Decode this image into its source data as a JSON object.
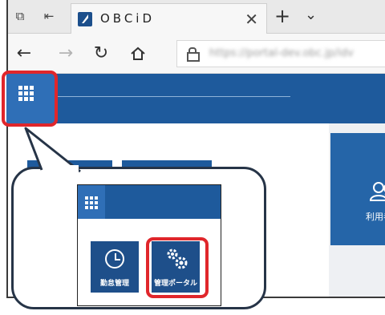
{
  "browser": {
    "tab": {
      "title": "OBCiD",
      "close": "✕"
    },
    "new_tab": "+",
    "tab_menu": "⌄",
    "url": "https://portal-dev.obc.jp/idv"
  },
  "tiles": {
    "users_label": "利用者"
  },
  "callout": {
    "attendance_label": "勤怠管理",
    "portal_label": "管理ポータル"
  },
  "colors": {
    "app_bar": "#1e5a9c",
    "grid_button": "#2f6fb7",
    "highlight": "#e0262b"
  }
}
